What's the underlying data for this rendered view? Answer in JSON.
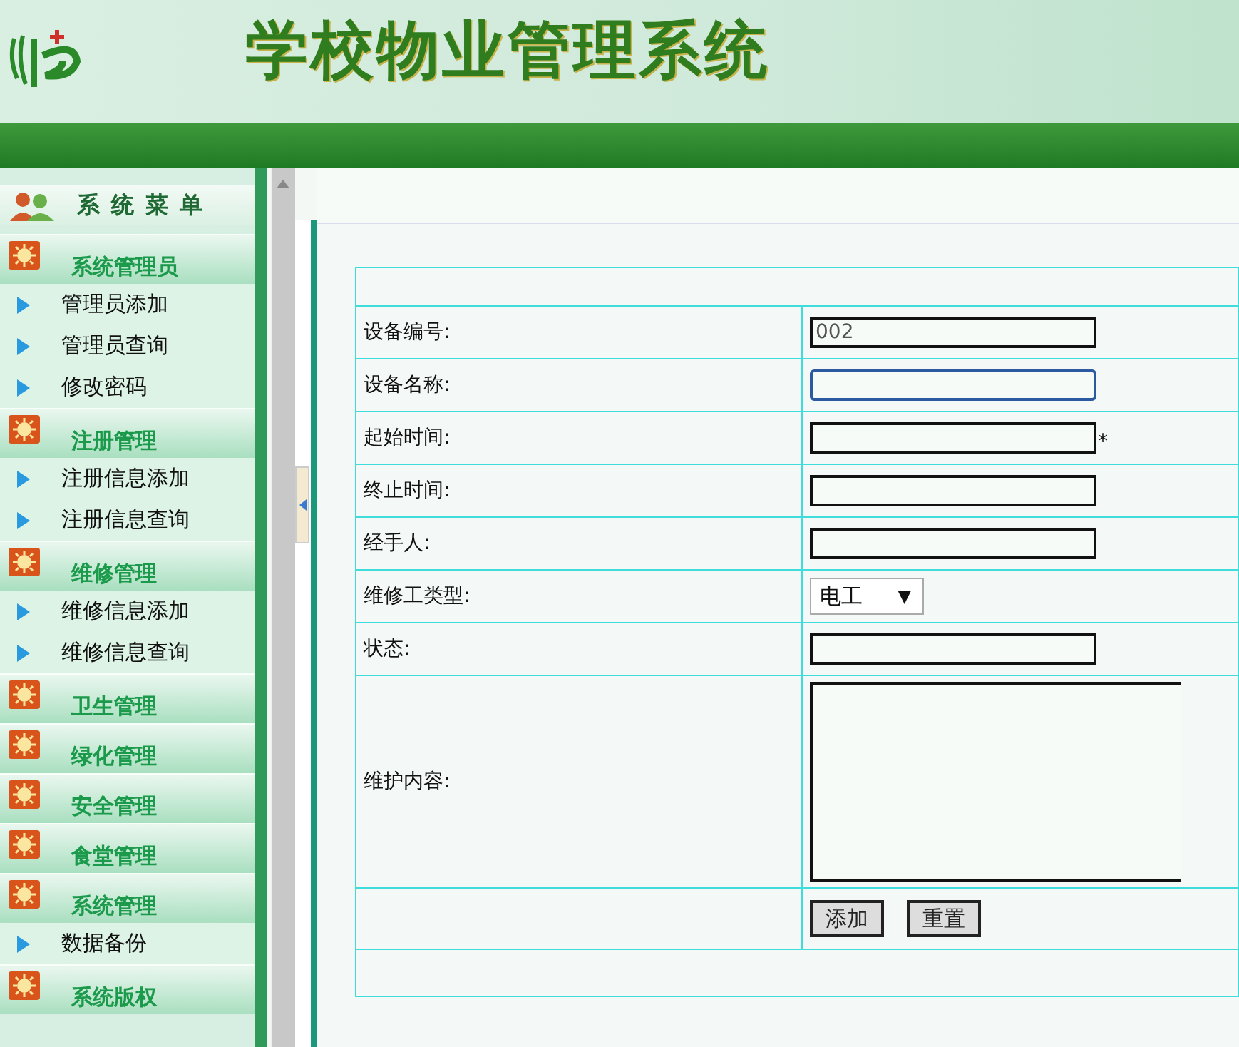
{
  "header": {
    "title": "学校物业管理系统"
  },
  "sidebar": {
    "title": "系统菜单",
    "groups": [
      {
        "label": "系统管理员",
        "items": [
          "管理员添加",
          "管理员查询",
          "修改密码"
        ]
      },
      {
        "label": "注册管理",
        "items": [
          "注册信息添加",
          "注册信息查询"
        ]
      },
      {
        "label": "维修管理",
        "items": [
          "维修信息添加",
          "维修信息查询"
        ]
      },
      {
        "label": "卫生管理"
      },
      {
        "label": "绿化管理"
      },
      {
        "label": "安全管理"
      },
      {
        "label": "食堂管理"
      },
      {
        "label": "系统管理",
        "items": [
          "数据备份"
        ]
      },
      {
        "label": "系统版权"
      }
    ]
  },
  "form": {
    "fields": [
      {
        "label": "设备编号:",
        "kind": "text",
        "value": "002",
        "focused": false
      },
      {
        "label": "设备名称:",
        "kind": "text",
        "focused": true
      },
      {
        "label": "起始时间:",
        "kind": "text",
        "focused": false,
        "required_mark": "*"
      },
      {
        "label": "终止时间:",
        "kind": "text",
        "focused": false
      },
      {
        "label": "经手人:",
        "kind": "text",
        "focused": false
      },
      {
        "label": "维修工类型:",
        "kind": "select",
        "value": "电工",
        "caret": "▼"
      },
      {
        "label": "状态:",
        "kind": "text",
        "focused": false
      },
      {
        "label": "维护内容:",
        "kind": "textarea"
      }
    ],
    "buttons": [
      "添加",
      "重置"
    ]
  }
}
